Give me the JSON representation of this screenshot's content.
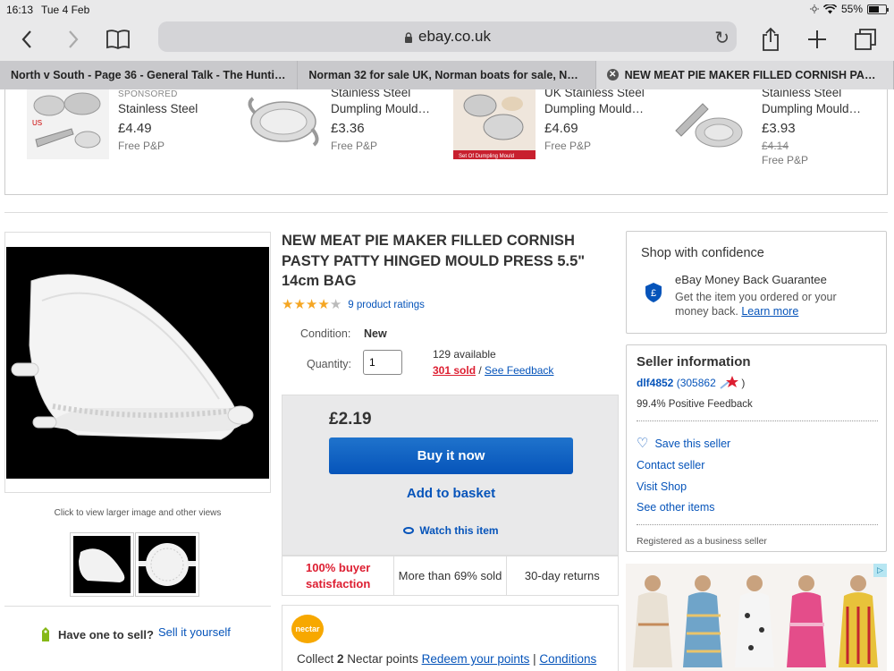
{
  "status": {
    "time": "16:13",
    "date": "Tue 4 Feb",
    "battery": "55%"
  },
  "browser": {
    "url": "ebay.co.uk",
    "tabs": [
      {
        "title": "North v South - Page 36 - General Talk - The Huntin..."
      },
      {
        "title": "Norman 32 for sale UK, Norman boats for sale, Nor..."
      },
      {
        "title": "NEW MEAT PIE MAKER FILLED CORNISH PASTY..."
      }
    ]
  },
  "sponsored": {
    "label": "SPONSORED",
    "items": [
      {
        "line1": "Stainless Steel",
        "price": "£4.49",
        "pp": "Free P&P"
      },
      {
        "line0": "Stainless Steel",
        "line1": "Dumpling Mould…",
        "price": "£3.36",
        "pp": "Free P&P"
      },
      {
        "line0": "UK Stainless Steel",
        "line1": "Dumpling Mould…",
        "price": "£4.69",
        "pp": "Free P&P"
      },
      {
        "line0": "Stainless Steel",
        "line1": "Dumpling Mould…",
        "price": "£3.93",
        "old_price": "£4.14",
        "pp": "Free P&P"
      }
    ]
  },
  "gallery": {
    "hint": "Click to view larger image and other views",
    "sell_question": "Have one to sell?",
    "sell_link": "Sell it yourself"
  },
  "item": {
    "title": "NEW MEAT PIE MAKER FILLED CORNISH PASTY PATTY HINGED MOULD PRESS 5.5\" 14cm BAG",
    "rating_stars": 4,
    "rating_max": 5,
    "ratings_link": "9 product ratings",
    "condition_label": "Condition:",
    "condition_value": "New",
    "quantity_label": "Quantity:",
    "quantity_value": "1",
    "available": "129 available",
    "sold": "301 sold",
    "sold_sep": " / ",
    "feedback_link": "See Feedback",
    "price": "£2.19",
    "buy_now": "Buy it now",
    "add_to_basket": "Add to basket",
    "watch": "Watch this item",
    "badges": [
      {
        "text": "100% buyer satisfaction"
      },
      {
        "text": "More than 69% sold"
      },
      {
        "text": "30-day returns"
      }
    ],
    "nectar": {
      "logo": "nectar",
      "text_pre": "Collect ",
      "points": "2",
      "text_post": " Nectar points ",
      "redeem_link": "Redeem your points",
      "sep": " | ",
      "conditions_link": "Conditions"
    }
  },
  "confidence": {
    "title": "Shop with confidence",
    "head": "eBay Money Back Guarantee",
    "sub": "Get the item you ordered or your money back.",
    "learn_more": "Learn more"
  },
  "seller": {
    "title": "Seller information",
    "username": "dlf4852",
    "score": "(305862",
    "score_end": " )",
    "feedback": "99.4% Positive Feedback",
    "save": "Save this seller",
    "contact": "Contact seller",
    "visit": "Visit Shop",
    "other": "See other items",
    "registered": "Registered as a business seller"
  },
  "colors": {
    "ebay_blue": "#0654ba",
    "buy_button": "#0654ba",
    "red": "#dd1e31",
    "star": "#f5a623"
  }
}
